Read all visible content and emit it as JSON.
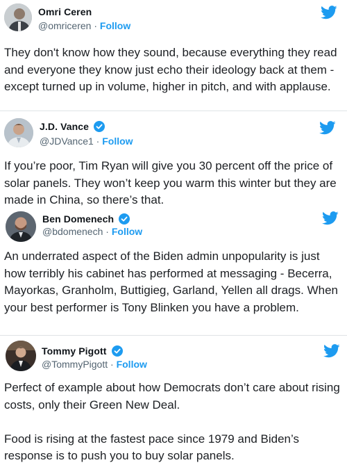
{
  "colors": {
    "accent": "#1d9bf0",
    "secondary_text": "#536471",
    "separator": "#dfe3e6"
  },
  "tweets": [
    {
      "name": "Omri Ceren",
      "handle": "@omriceren",
      "separator": "·",
      "follow_label": "Follow",
      "verified": false,
      "text": "They don't know how they sound, because everything they read and everyone they know just echo their ideology back at them - except turned up in volume, higher in pitch, and with applause."
    },
    {
      "name": "J.D. Vance",
      "handle": "@JDVance1",
      "separator": "·",
      "follow_label": "Follow",
      "verified": true,
      "text": "If you’re poor, Tim Ryan will give you 30 percent off the price of solar panels. They won’t keep you warm this winter but they are made in China, so there’s that."
    },
    {
      "name": "Ben Domenech",
      "handle": "@bdomenech",
      "separator": "·",
      "follow_label": "Follow",
      "verified": true,
      "text": "An underrated aspect of the Biden admin unpopularity is just how terribly his cabinet has performed at messaging - Becerra, Mayorkas, Granholm, Buttigieg, Garland, Yellen all drags. When your best performer is Tony Blinken you have a problem."
    },
    {
      "name": "Tommy Pigott",
      "handle": "@TommyPigott",
      "separator": "·",
      "follow_label": "Follow",
      "verified": true,
      "text": "Perfect of example about how Democrats don’t care about rising costs, only their Green New Deal.\n\nFood is rising at the fastest pace since 1979 and Biden’s response is to push you to buy solar panels."
    }
  ]
}
